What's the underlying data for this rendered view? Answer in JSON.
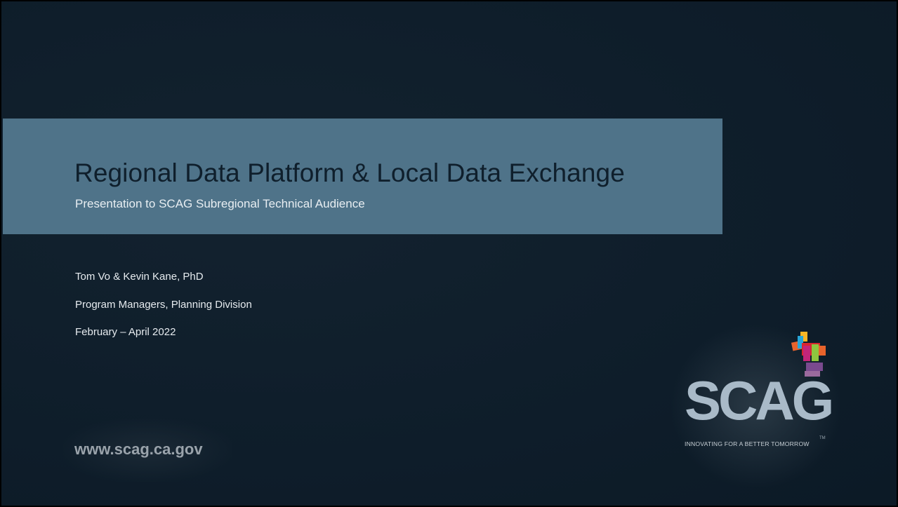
{
  "slide": {
    "title": "Regional Data Platform & Local Data Exchange",
    "subtitle": "Presentation to SCAG Subregional Technical Audience",
    "author": "Tom Vo & Kevin Kane, PhD",
    "role": "Program Managers, Planning Division",
    "dates": "February – April 2022",
    "website": "www.scag.ca.gov"
  },
  "logo": {
    "text": "SCAG",
    "tm": "TM",
    "tagline": "INNOVATING FOR A BETTER TOMORROW",
    "colors": {
      "orange": "#e8632b",
      "red": "#d8262f",
      "magenta": "#c2257a",
      "green": "#8ec63f",
      "blue": "#27a6d9",
      "yellow": "#f7b526",
      "purple": "#7a4a8f",
      "text": "#a9bac8"
    }
  },
  "theme": {
    "background": "#0f1e2b",
    "band": "#4f7389"
  }
}
